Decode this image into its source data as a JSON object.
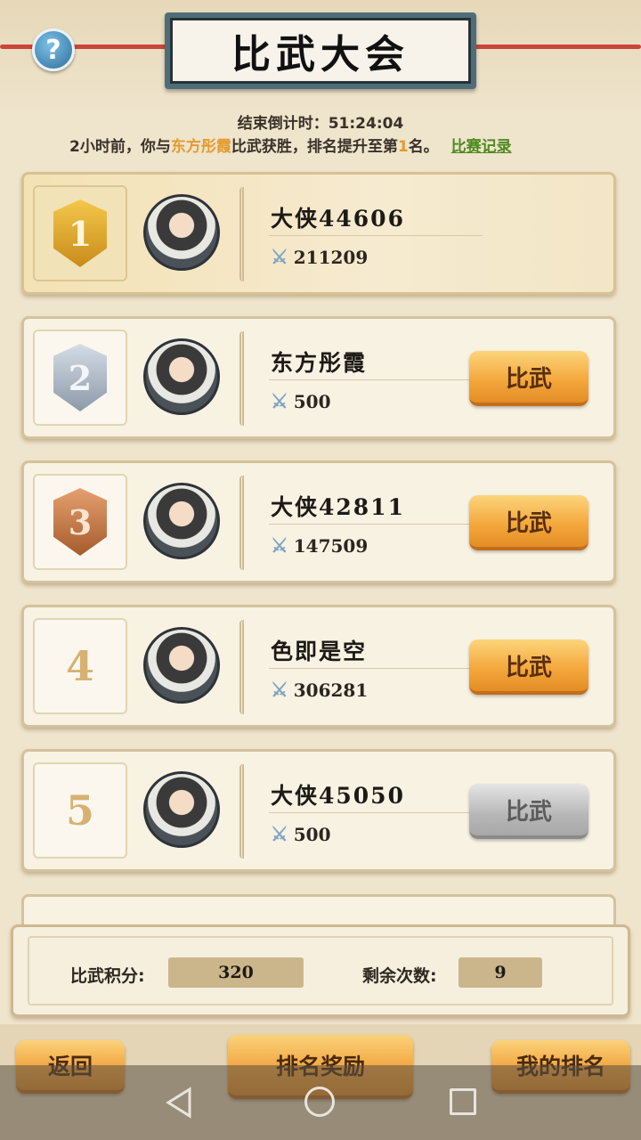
{
  "header": {
    "title": "比武大会",
    "help_label": "?"
  },
  "countdown": {
    "label": "结束倒计时：",
    "time": "51:24:04"
  },
  "notice": {
    "prefix": "2小时前，你与",
    "opponent": "东方彤霞",
    "middle": "比武获胜，排名提升至第",
    "rank": "1",
    "suffix": "名。",
    "record_link": "比赛记录"
  },
  "ranking": [
    {
      "rank": "1",
      "name": "大侠44606",
      "power": "211209",
      "button": ""
    },
    {
      "rank": "2",
      "name": "东方彤霞",
      "power": "500",
      "button": "比武"
    },
    {
      "rank": "3",
      "name": "大侠42811",
      "power": "147509",
      "button": "比武"
    },
    {
      "rank": "4",
      "name": "色即是空",
      "power": "306281",
      "button": "比武"
    },
    {
      "rank": "5",
      "name": "大侠45050",
      "power": "500",
      "button": "比武",
      "disabled": true
    }
  ],
  "stats": {
    "score_label": "比武积分:",
    "score_value": "320",
    "remaining_label": "剩余次数:",
    "remaining_value": "9"
  },
  "bottom_bar": {
    "back": "返回",
    "rank_reward": "排名奖励",
    "my_rank": "我的排名"
  },
  "icons": {
    "power": "crossed-swords-icon",
    "help": "question-icon"
  },
  "colors": {
    "accent_orange": "#f3a53a",
    "highlight_text": "#e39b2f",
    "link_green": "#4d8a1f",
    "title_frame": "#4f6d78"
  }
}
